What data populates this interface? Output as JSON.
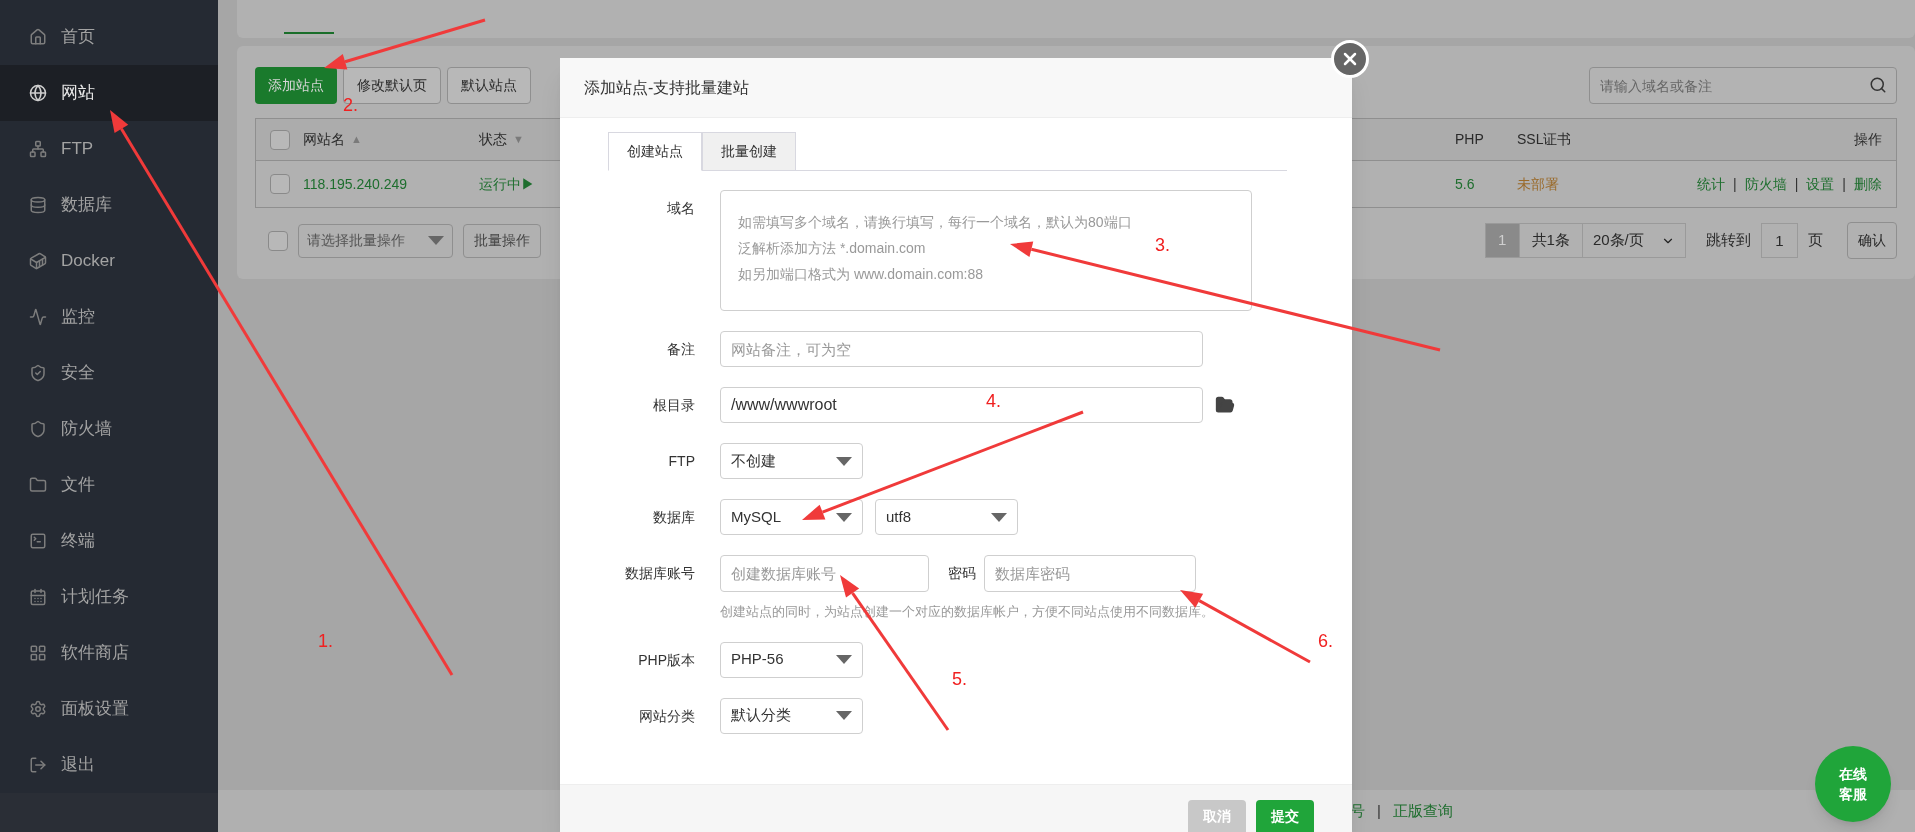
{
  "sidebar": {
    "items": [
      {
        "label": "首页",
        "selected": false
      },
      {
        "label": "网站",
        "selected": true
      },
      {
        "label": "FTP",
        "selected": false
      },
      {
        "label": "数据库",
        "selected": false
      },
      {
        "label": "Docker",
        "selected": false
      },
      {
        "label": "监控",
        "selected": false
      },
      {
        "label": "安全",
        "selected": false
      },
      {
        "label": "防火墙",
        "selected": false
      },
      {
        "label": "文件",
        "selected": false
      },
      {
        "label": "终端",
        "selected": false
      },
      {
        "label": "计划任务",
        "selected": false
      },
      {
        "label": "软件商店",
        "selected": false
      },
      {
        "label": "面板设置",
        "selected": false
      },
      {
        "label": "退出",
        "selected": false
      }
    ]
  },
  "toolbar": {
    "buttons": [
      {
        "label": "添加站点",
        "kind": "primary"
      },
      {
        "label": "修改默认页",
        "kind": "default"
      },
      {
        "label": "默认站点",
        "kind": "default"
      }
    ],
    "search": {
      "placeholder": "请输入域名或备注"
    }
  },
  "table": {
    "header_checked": false,
    "columns": [
      {
        "label": "网站名",
        "sort_icon": "▲"
      },
      {
        "label": "状态",
        "sort_icon": "▼"
      },
      {
        "label": "PHP"
      },
      {
        "label": "SSL证书"
      },
      {
        "label": "操作"
      }
    ],
    "rows": [
      {
        "checked": false,
        "name": "118.195.240.249",
        "status": "运行中▶",
        "php": "5.6",
        "ssl": "未部署",
        "actions": [
          "统计",
          "防火墙",
          "设置",
          "删除"
        ],
        "separators": [
          "|",
          "|",
          "|"
        ]
      }
    ]
  },
  "batch": {
    "checked": false,
    "select": "请选择批量操作",
    "button": "批量操作"
  },
  "pagination": {
    "pages": [
      {
        "label": "1",
        "selected": true
      }
    ],
    "total": "共1条",
    "per_page": "20条/页",
    "jump_label": "跳转到",
    "jump_value": "1",
    "page_unit": "页",
    "confirm": "确认"
  },
  "footer": {
    "links": [
      "号",
      "正版查询"
    ],
    "separators": [
      "|"
    ]
  },
  "chat_button": {
    "lines": [
      "在线",
      "客服"
    ]
  },
  "modal": {
    "title": "添加站点-支持批量建站",
    "tabs": [
      {
        "label": "创建站点",
        "selected": true
      },
      {
        "label": "批量创建",
        "selected": false
      }
    ],
    "fields": [
      {
        "kind": "textarea",
        "label": "域名",
        "placeholder": [
          "如需填写多个域名，请换行填写，每行一个域名，默认为80端口",
          "泛解析添加方法 *.domain.com",
          "如另加端口格式为 www.domain.com:88"
        ]
      },
      {
        "kind": "input",
        "label": "备注",
        "placeholder": "网站备注，可为空"
      },
      {
        "kind": "path",
        "label": "根目录",
        "value": "/www/wwwroot"
      },
      {
        "kind": "select",
        "label": "FTP",
        "selects": [
          "不创建"
        ]
      },
      {
        "kind": "select",
        "label": "数据库",
        "selects": [
          "MySQL",
          "utf8"
        ]
      },
      {
        "kind": "credentials",
        "label": "数据库账号",
        "placeholder": "创建数据库账号",
        "password_label": "密码",
        "password_placeholder": "数据库密码",
        "help": "创建站点的同时，为站点创建一个对应的数据库帐户，方便不同站点使用不同数据库。"
      },
      {
        "kind": "select",
        "label": "PHP版本",
        "selects": [
          "PHP-56"
        ]
      },
      {
        "kind": "select",
        "label": "网站分类",
        "selects": [
          "默认分类"
        ]
      }
    ],
    "buttons": [
      {
        "label": "取消",
        "kind": "cancel"
      },
      {
        "label": "提交",
        "kind": "primary"
      }
    ]
  },
  "annotations": [
    {
      "label": "1."
    },
    {
      "label": "2."
    },
    {
      "label": "3."
    },
    {
      "label": "4."
    },
    {
      "label": "5."
    },
    {
      "label": "6."
    }
  ]
}
